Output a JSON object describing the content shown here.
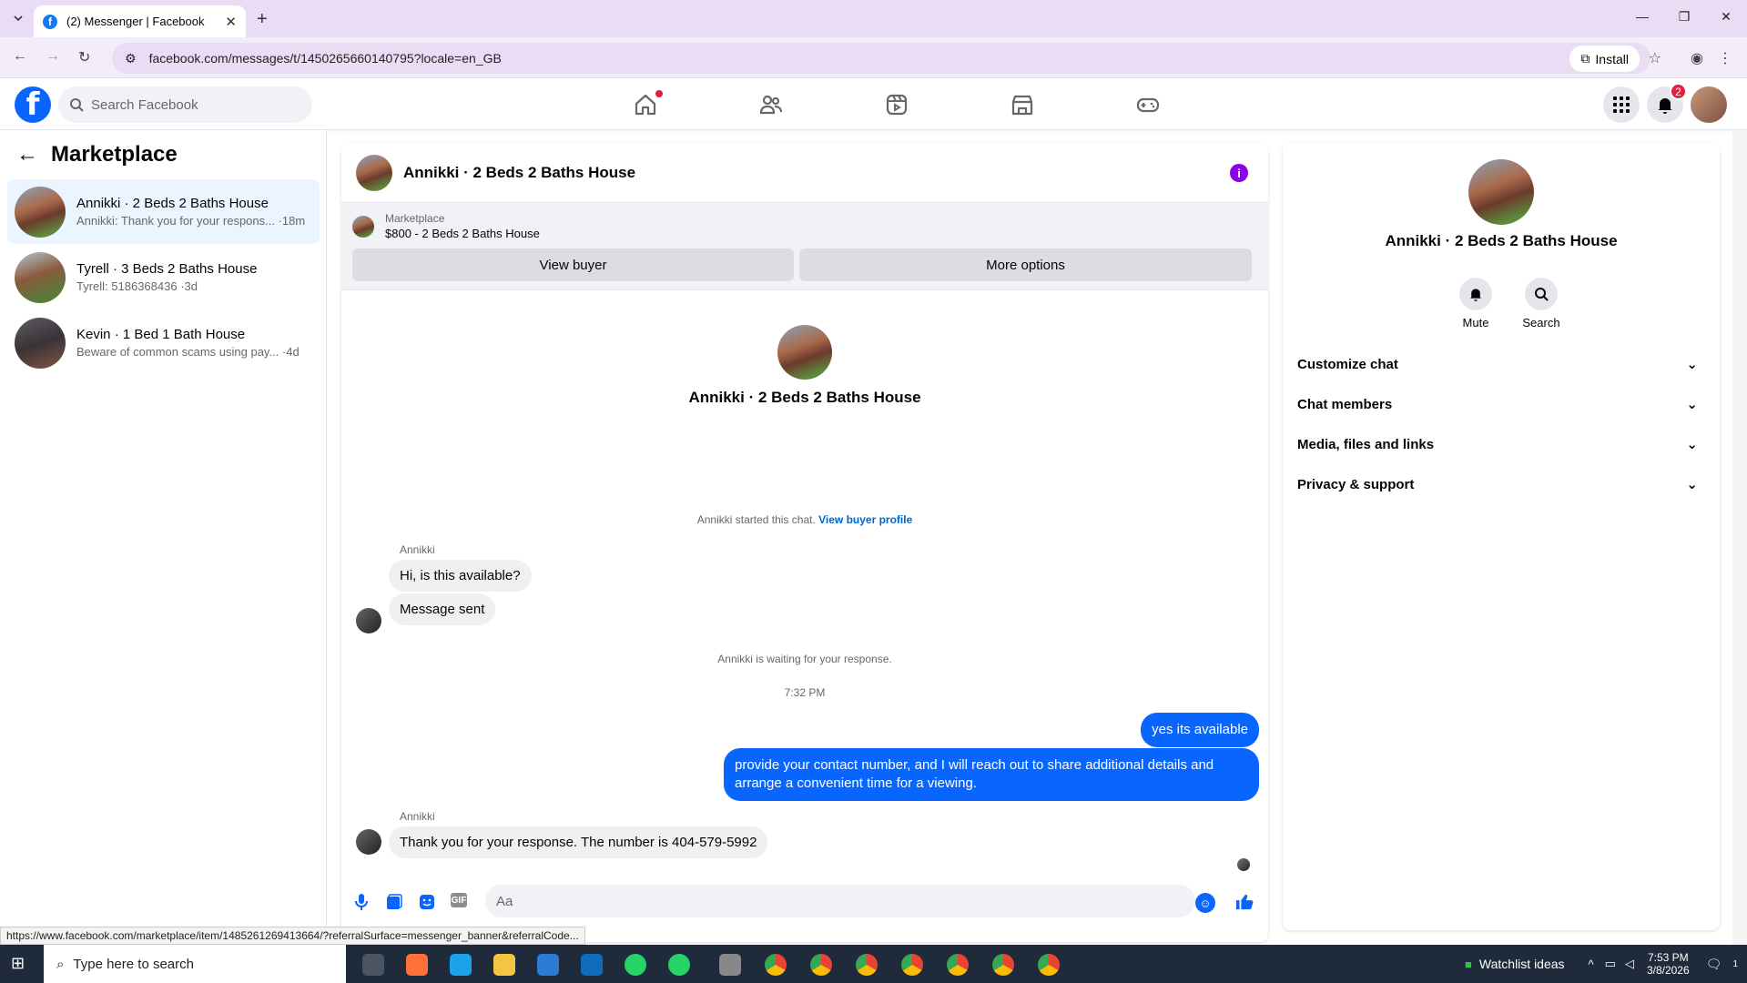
{
  "browser": {
    "tab_title": "(2) Messenger | Facebook",
    "url": "facebook.com/messages/t/1450265660140795?locale=en_GB",
    "install_label": "Install",
    "status_url": "https://www.facebook.com/marketplace/item/1485261269413664/?referralSurface=messenger_banner&referralCode..."
  },
  "header": {
    "search_placeholder": "Search Facebook",
    "notif_count": "2"
  },
  "left": {
    "title": "Marketplace",
    "conversations": [
      {
        "title": "Annikki · 2 Beds 2 Baths House",
        "snippet": "Annikki: Thank you for your respons... ·18m"
      },
      {
        "title": "Tyrell · 3 Beds 2 Baths House",
        "snippet": "Tyrell: 5186368436 ·3d"
      },
      {
        "title": "Kevin · 1 Bed 1 Bath House",
        "snippet": "Beware of common scams using pay... ·4d"
      }
    ]
  },
  "chat": {
    "title": "Annikki · 2 Beds 2 Baths House",
    "banner": {
      "label": "Marketplace",
      "item": "$800 - 2 Beds 2 Baths House",
      "view_buyer": "View buyer",
      "more_options": "More options"
    },
    "intro_name": "Annikki · 2 Beds 2 Baths House",
    "started": "Annikki started this chat.",
    "view_buyer_profile": "View buyer profile",
    "sender": "Annikki",
    "msg1": "Hi, is this available?",
    "msg2": "Message sent",
    "waiting": "Annikki is waiting for your response.",
    "time": "7:32 PM",
    "out1": "yes its available",
    "out2": "provide your contact number, and I will reach out to share additional details and arrange a convenient time for a viewing.",
    "sender2": "Annikki",
    "msg3": "Thank you for your response. The number is 404-579-5992",
    "composer_placeholder": "Aa"
  },
  "right": {
    "name": "Annikki · 2 Beds 2 Baths House",
    "mute": "Mute",
    "search": "Search",
    "rows": [
      "Customize chat",
      "Chat members",
      "Media, files and links",
      "Privacy & support"
    ]
  },
  "taskbar": {
    "search_placeholder": "Type here to search",
    "watchlist": "Watchlist ideas",
    "time": "7:53 PM",
    "date": "3/8/2026",
    "notif": "1"
  },
  "colors": {
    "fb_blue": "#0866ff",
    "outgoing_bubble": "#0866ff",
    "info_purple": "#8a00e8",
    "badge_red": "#e41e3f"
  }
}
